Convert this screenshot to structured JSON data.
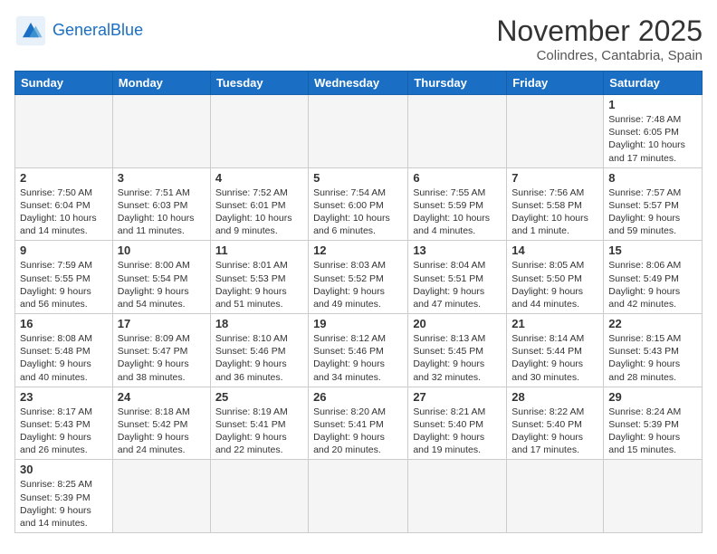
{
  "header": {
    "logo_general": "General",
    "logo_blue": "Blue",
    "month_title": "November 2025",
    "subtitle": "Colindres, Cantabria, Spain"
  },
  "weekdays": [
    "Sunday",
    "Monday",
    "Tuesday",
    "Wednesday",
    "Thursday",
    "Friday",
    "Saturday"
  ],
  "days": [
    {
      "num": "",
      "info": "",
      "empty": true
    },
    {
      "num": "",
      "info": "",
      "empty": true
    },
    {
      "num": "",
      "info": "",
      "empty": true
    },
    {
      "num": "",
      "info": "",
      "empty": true
    },
    {
      "num": "",
      "info": "",
      "empty": true
    },
    {
      "num": "",
      "info": "",
      "empty": true
    },
    {
      "num": "1",
      "info": "Sunrise: 7:48 AM\nSunset: 6:05 PM\nDaylight: 10 hours\nand 17 minutes."
    },
    {
      "num": "2",
      "info": "Sunrise: 7:50 AM\nSunset: 6:04 PM\nDaylight: 10 hours\nand 14 minutes."
    },
    {
      "num": "3",
      "info": "Sunrise: 7:51 AM\nSunset: 6:03 PM\nDaylight: 10 hours\nand 11 minutes."
    },
    {
      "num": "4",
      "info": "Sunrise: 7:52 AM\nSunset: 6:01 PM\nDaylight: 10 hours\nand 9 minutes."
    },
    {
      "num": "5",
      "info": "Sunrise: 7:54 AM\nSunset: 6:00 PM\nDaylight: 10 hours\nand 6 minutes."
    },
    {
      "num": "6",
      "info": "Sunrise: 7:55 AM\nSunset: 5:59 PM\nDaylight: 10 hours\nand 4 minutes."
    },
    {
      "num": "7",
      "info": "Sunrise: 7:56 AM\nSunset: 5:58 PM\nDaylight: 10 hours\nand 1 minute."
    },
    {
      "num": "8",
      "info": "Sunrise: 7:57 AM\nSunset: 5:57 PM\nDaylight: 9 hours\nand 59 minutes."
    },
    {
      "num": "9",
      "info": "Sunrise: 7:59 AM\nSunset: 5:55 PM\nDaylight: 9 hours\nand 56 minutes."
    },
    {
      "num": "10",
      "info": "Sunrise: 8:00 AM\nSunset: 5:54 PM\nDaylight: 9 hours\nand 54 minutes."
    },
    {
      "num": "11",
      "info": "Sunrise: 8:01 AM\nSunset: 5:53 PM\nDaylight: 9 hours\nand 51 minutes."
    },
    {
      "num": "12",
      "info": "Sunrise: 8:03 AM\nSunset: 5:52 PM\nDaylight: 9 hours\nand 49 minutes."
    },
    {
      "num": "13",
      "info": "Sunrise: 8:04 AM\nSunset: 5:51 PM\nDaylight: 9 hours\nand 47 minutes."
    },
    {
      "num": "14",
      "info": "Sunrise: 8:05 AM\nSunset: 5:50 PM\nDaylight: 9 hours\nand 44 minutes."
    },
    {
      "num": "15",
      "info": "Sunrise: 8:06 AM\nSunset: 5:49 PM\nDaylight: 9 hours\nand 42 minutes."
    },
    {
      "num": "16",
      "info": "Sunrise: 8:08 AM\nSunset: 5:48 PM\nDaylight: 9 hours\nand 40 minutes."
    },
    {
      "num": "17",
      "info": "Sunrise: 8:09 AM\nSunset: 5:47 PM\nDaylight: 9 hours\nand 38 minutes."
    },
    {
      "num": "18",
      "info": "Sunrise: 8:10 AM\nSunset: 5:46 PM\nDaylight: 9 hours\nand 36 minutes."
    },
    {
      "num": "19",
      "info": "Sunrise: 8:12 AM\nSunset: 5:46 PM\nDaylight: 9 hours\nand 34 minutes."
    },
    {
      "num": "20",
      "info": "Sunrise: 8:13 AM\nSunset: 5:45 PM\nDaylight: 9 hours\nand 32 minutes."
    },
    {
      "num": "21",
      "info": "Sunrise: 8:14 AM\nSunset: 5:44 PM\nDaylight: 9 hours\nand 30 minutes."
    },
    {
      "num": "22",
      "info": "Sunrise: 8:15 AM\nSunset: 5:43 PM\nDaylight: 9 hours\nand 28 minutes."
    },
    {
      "num": "23",
      "info": "Sunrise: 8:17 AM\nSunset: 5:43 PM\nDaylight: 9 hours\nand 26 minutes."
    },
    {
      "num": "24",
      "info": "Sunrise: 8:18 AM\nSunset: 5:42 PM\nDaylight: 9 hours\nand 24 minutes."
    },
    {
      "num": "25",
      "info": "Sunrise: 8:19 AM\nSunset: 5:41 PM\nDaylight: 9 hours\nand 22 minutes."
    },
    {
      "num": "26",
      "info": "Sunrise: 8:20 AM\nSunset: 5:41 PM\nDaylight: 9 hours\nand 20 minutes."
    },
    {
      "num": "27",
      "info": "Sunrise: 8:21 AM\nSunset: 5:40 PM\nDaylight: 9 hours\nand 19 minutes."
    },
    {
      "num": "28",
      "info": "Sunrise: 8:22 AM\nSunset: 5:40 PM\nDaylight: 9 hours\nand 17 minutes."
    },
    {
      "num": "29",
      "info": "Sunrise: 8:24 AM\nSunset: 5:39 PM\nDaylight: 9 hours\nand 15 minutes."
    },
    {
      "num": "30",
      "info": "Sunrise: 8:25 AM\nSunset: 5:39 PM\nDaylight: 9 hours\nand 14 minutes."
    },
    {
      "num": "",
      "info": "",
      "empty": true
    },
    {
      "num": "",
      "info": "",
      "empty": true
    },
    {
      "num": "",
      "info": "",
      "empty": true
    },
    {
      "num": "",
      "info": "",
      "empty": true
    },
    {
      "num": "",
      "info": "",
      "empty": true
    },
    {
      "num": "",
      "info": "",
      "empty": true
    }
  ]
}
